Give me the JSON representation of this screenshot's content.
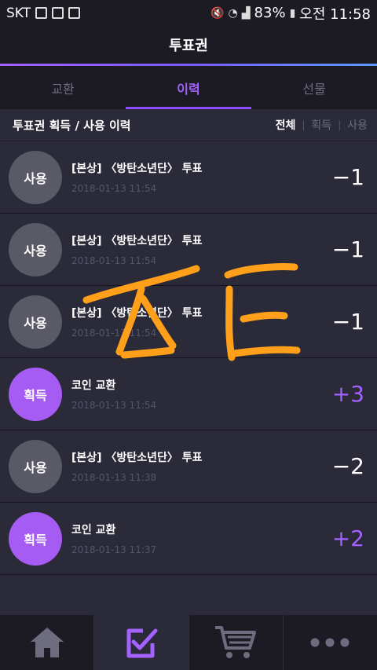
{
  "status_bar": {
    "carrier": "SKT",
    "battery": "83%",
    "time": "오전 11:58"
  },
  "header": {
    "title": "투표권"
  },
  "tabs": [
    {
      "label": "교환",
      "active": false
    },
    {
      "label": "이력",
      "active": true
    },
    {
      "label": "선물",
      "active": false
    }
  ],
  "filter_bar": {
    "title": "투표권 획득 / 사용 이력",
    "options": [
      "전체",
      "획득",
      "사용"
    ],
    "selected": "전체"
  },
  "history": [
    {
      "badge": "사용",
      "type": "use",
      "title": "[본상] 〈방탄소년단〉 투표",
      "time": "2018-01-13 11:54",
      "amount": "−1"
    },
    {
      "badge": "사용",
      "type": "use",
      "title": "[본상] 〈방탄소년단〉 투표",
      "time": "2018-01-13 11:54",
      "amount": "−1"
    },
    {
      "badge": "사용",
      "type": "use",
      "title": "[본상] 〈방탄소년단〉 투표",
      "time": "2018-01-13 11:54",
      "amount": "−1"
    },
    {
      "badge": "획득",
      "type": "get",
      "title": "코인 교환",
      "time": "2018-01-13 11:54",
      "amount": "+3"
    },
    {
      "badge": "사용",
      "type": "use",
      "title": "[본상] 〈방탄소년단〉 투표",
      "time": "2018-01-13 11:38",
      "amount": "−2"
    },
    {
      "badge": "획득",
      "type": "get",
      "title": "코인 교환",
      "time": "2018-01-13 11:37",
      "amount": "+2"
    }
  ],
  "bottom_nav": {
    "items": [
      {
        "icon": "home-icon",
        "active": false
      },
      {
        "icon": "vote-check-icon",
        "active": true
      },
      {
        "icon": "cart-icon",
        "active": false
      },
      {
        "icon": "more-icon",
        "active": false
      }
    ]
  },
  "colors": {
    "accent": "#a361ff",
    "background": "#2b2a38",
    "bar": "#1c1b24",
    "use_badge": "#5a5a66",
    "get_badge": "#a65cf3",
    "scribble": "#ff9f1a"
  }
}
